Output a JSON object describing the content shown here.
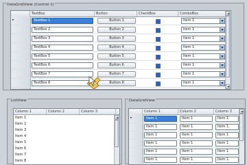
{
  "top_group": {
    "title": "DataGridView (Control 1)",
    "columns": [
      "TextBox",
      "Button",
      "CheckBox",
      "ComboBox"
    ],
    "current_row_marker": "▸",
    "rows": [
      {
        "text": "TextBox 1",
        "button": "Button 1",
        "checked": true,
        "combo": "Item 1"
      },
      {
        "text": "TextBox 2",
        "button": "Button 2",
        "checked": true,
        "combo": "Item 1"
      },
      {
        "text": "TextBox 3",
        "button": "Button 3",
        "checked": true,
        "combo": "Item 1"
      },
      {
        "text": "TextBox 4",
        "button": "Button 4",
        "checked": true,
        "combo": "Item 1"
      },
      {
        "text": "TextBox 5",
        "button": "Button 5",
        "checked": true,
        "combo": "Item 1"
      },
      {
        "text": "TextBox 6",
        "button": "Button 6",
        "checked": true,
        "combo": "Item 1"
      },
      {
        "text": "TextBox 7",
        "button": "Button 7",
        "checked": true,
        "combo": "Item 1"
      },
      {
        "text": "TextBox 8",
        "button": "Button 8",
        "checked": true,
        "combo": "Item 1"
      }
    ]
  },
  "left_group": {
    "title": "ListView",
    "columns": [
      "Column 1",
      "Column 2",
      "Column 3"
    ],
    "items": [
      "Item 1",
      "Item 2",
      "Item 3",
      "Item 4",
      "Item 5",
      "Item 6",
      "Item 7",
      "Item 8"
    ]
  },
  "right_group": {
    "title": "DataGridView",
    "columns": [
      "Column 1",
      "Column 2",
      "Column 3"
    ],
    "current_row_marker": "▸",
    "rows": [
      [
        "Item 1",
        "Item 1",
        "Item 1"
      ],
      [
        "Item 1",
        "Item 1",
        "Item 1"
      ],
      [
        "Item 1",
        "Item 1",
        "Item 1"
      ],
      [
        "Item 1",
        "Item 1",
        "Item 1"
      ],
      [
        "Item 1",
        "Item 1",
        "Item 1"
      ],
      [
        "Item 1",
        "Item 1",
        "Item 1"
      ]
    ]
  },
  "icons": {
    "scroll_up": "scroll-up-arrow-icon",
    "scroll_down": "scroll-down-arrow-icon",
    "dropdown": "dropdown-arrow-icon",
    "cursor": "cursor-icon"
  },
  "colors": {
    "selection": "#3b80d8",
    "window_bg": "#cfd4da",
    "checkbox_fill": "#2f5fbf"
  }
}
